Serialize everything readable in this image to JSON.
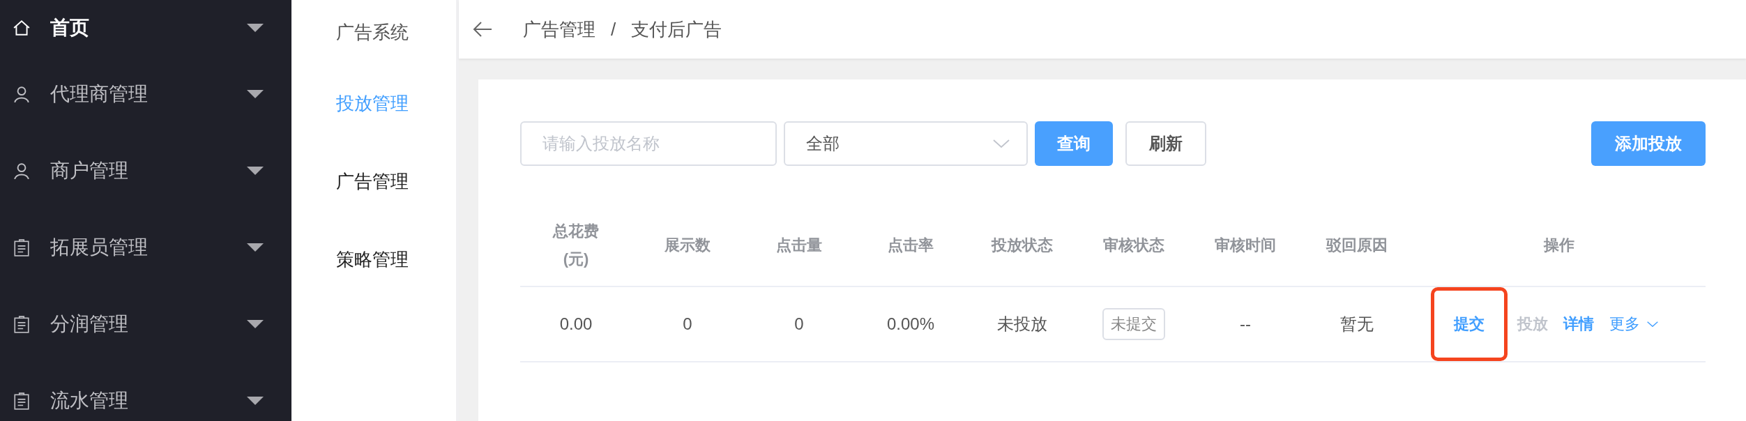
{
  "sidebar": {
    "items": [
      {
        "label": "首页",
        "kind": "home",
        "selected": true
      },
      {
        "label": "代理商管理",
        "kind": "user",
        "selected": false
      },
      {
        "label": "商户管理",
        "kind": "user",
        "selected": false
      },
      {
        "label": "拓展员管理",
        "kind": "clipboard",
        "selected": false
      },
      {
        "label": "分润管理",
        "kind": "clipboard",
        "selected": false
      },
      {
        "label": "流水管理",
        "kind": "clipboard",
        "selected": false
      }
    ]
  },
  "subnav": {
    "title": "广告系统",
    "items": [
      {
        "label": "投放管理",
        "selected": true
      },
      {
        "label": "广告管理",
        "selected": false
      },
      {
        "label": "策略管理",
        "selected": false
      }
    ]
  },
  "breadcrumb": [
    "广告管理",
    "/",
    "支付后广告"
  ],
  "filters": {
    "search": {
      "placeholder": "请输入投放名称"
    },
    "status_select": {
      "value": "全部"
    },
    "query_button": "查询",
    "refresh_button": "刷新",
    "add_button": "添加投放"
  },
  "table": {
    "columns": [
      "总花费(元)",
      "展示数",
      "点击量",
      "点击率",
      "投放状态",
      "审核状态",
      "审核时间",
      "驳回原因",
      "操作"
    ],
    "rows": [
      {
        "cells": [
          "0.00",
          "0",
          "0",
          "0.00%",
          "未投放"
        ],
        "review_status": "未提交",
        "review_time": "--",
        "reject_reason": "暂无",
        "actions": [
          {
            "label": "提交",
            "kind": "link",
            "disabled": false,
            "highlighted": true
          },
          {
            "label": "投放",
            "kind": "link",
            "disabled": true,
            "highlighted": false
          },
          {
            "label": "详情",
            "kind": "link",
            "disabled": false,
            "highlighted": false
          },
          {
            "label": "更多",
            "kind": "dropdown",
            "disabled": false,
            "highlighted": false
          }
        ]
      }
    ]
  }
}
